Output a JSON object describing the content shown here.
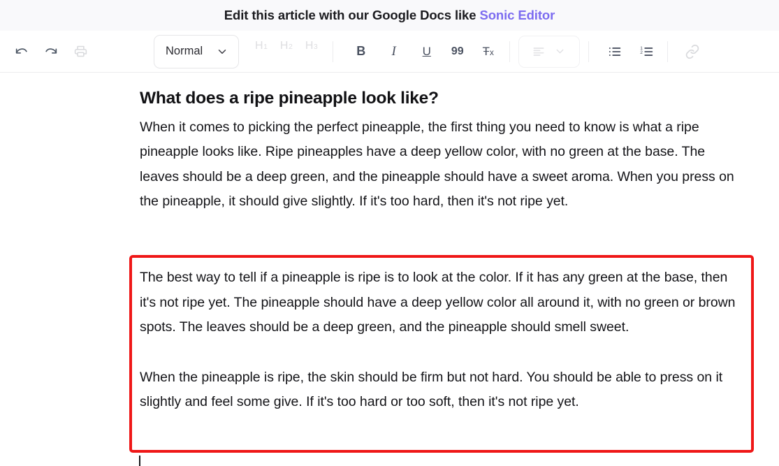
{
  "header": {
    "text_before": "Edit this article with our Google Docs like ",
    "link_label": "Sonic Editor",
    "link_color": "#7c6cf0",
    "background": "#f9f9fb"
  },
  "toolbar": {
    "undo_label": "undo-arrow",
    "redo_label": "redo-arrow",
    "print_label": "printer",
    "style_dropdown": {
      "value": "Normal",
      "caret": "chevron-down"
    },
    "headings": [
      {
        "label": "H",
        "sub": "1",
        "name": "heading-1"
      },
      {
        "label": "H",
        "sub": "2",
        "name": "heading-2"
      },
      {
        "label": "H",
        "sub": "3",
        "name": "heading-3"
      }
    ],
    "format": [
      {
        "label": "B",
        "name": "bold"
      },
      {
        "label": "I",
        "name": "italic"
      },
      {
        "label": "U",
        "name": "underline"
      },
      {
        "label": "99",
        "name": "blockquote"
      },
      {
        "label": "Tx",
        "name": "clear-formatting"
      }
    ],
    "align_label": "align-left",
    "align_caret": "chevron-down",
    "bullet_list_label": "bulleted-list",
    "numbered_list_label": "numbered-list",
    "link_label": "insert-link"
  },
  "document": {
    "title": "What does a ripe pineapple look like?",
    "paragraph_1": "When it comes to picking the perfect pineapple, the first thing you need to know is what a ripe pineapple looks like. Ripe pineapples have a deep yellow color, with no green at the base. The leaves should be a deep green, and the pineapple should have a sweet aroma. When you press on the pineapple, it should give slightly. If it's too hard, then it's not ripe yet.",
    "selected": {
      "border_color": "#ef1717",
      "paragraph_1": "The best way to tell if a pineapple is ripe is to look at the color. If it has any green at the base, then it's not ripe yet. The pineapple should have a deep yellow color all around it, with no green or brown spots. The leaves should be a deep green, and the pineapple should smell sweet.",
      "paragraph_2": "When the pineapple is ripe, the skin should be firm but not hard. You should be able to press on it slightly and feel some give. If it's too hard or too soft, then it's not ripe yet."
    }
  }
}
